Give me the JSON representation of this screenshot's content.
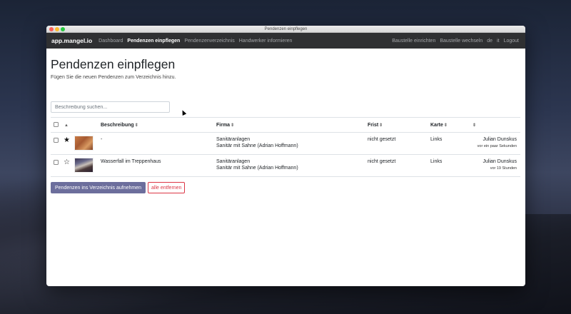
{
  "window": {
    "title": "Pendenzen einpflegen"
  },
  "navbar": {
    "brand": "app.mangel.io",
    "links": [
      "Dashboard",
      "Pendenzen einpflegen",
      "Pendenzenverzeichnis",
      "Handwerker informieren"
    ],
    "right_links": [
      "Baustelle einrichten",
      "Baustelle wechseln",
      "de",
      "it",
      "Logout"
    ]
  },
  "page": {
    "title": "Pendenzen einpflegen",
    "subtitle": "Fügen Sie die neuen Pendenzen zum Verzeichnis hinzu."
  },
  "search": {
    "placeholder": "Beschreibung suchen...",
    "value": ""
  },
  "table": {
    "headers": {
      "beschreibung": "Beschreibung",
      "firma": "Firma",
      "frist": "Frist",
      "karte": "Karte",
      "sort_icon": "⇕",
      "star_sort_icon": "▲"
    },
    "rows": [
      {
        "starred": true,
        "star": "★",
        "beschreibung": "-",
        "firma_1": "Sanitäranlagen",
        "firma_2": "Sanitär mit Sahne (Adrian Hoffmann)",
        "frist": "nicht gesetzt",
        "karte": "Links",
        "user": "Julian Dunskus",
        "time": "vor ein paar Sekunden"
      },
      {
        "starred": false,
        "star": "☆",
        "beschreibung": "Wasserfall im Treppenhaus",
        "firma_1": "Sanitäranlagen",
        "firma_2": "Sanitär mit Sahne (Adrian Hoffmann)",
        "frist": "nicht gesetzt",
        "karte": "Links",
        "user": "Julian Dunskus",
        "time": "vor 19 Stunden"
      }
    ]
  },
  "actions": {
    "add": "Pendenzen ins Verzeichnis aufnehmen",
    "remove_all": "alle entfernen"
  },
  "colors": {
    "navbar": "#2f3032",
    "primary_button": "#6c6e9c",
    "danger": "#dc3545"
  }
}
